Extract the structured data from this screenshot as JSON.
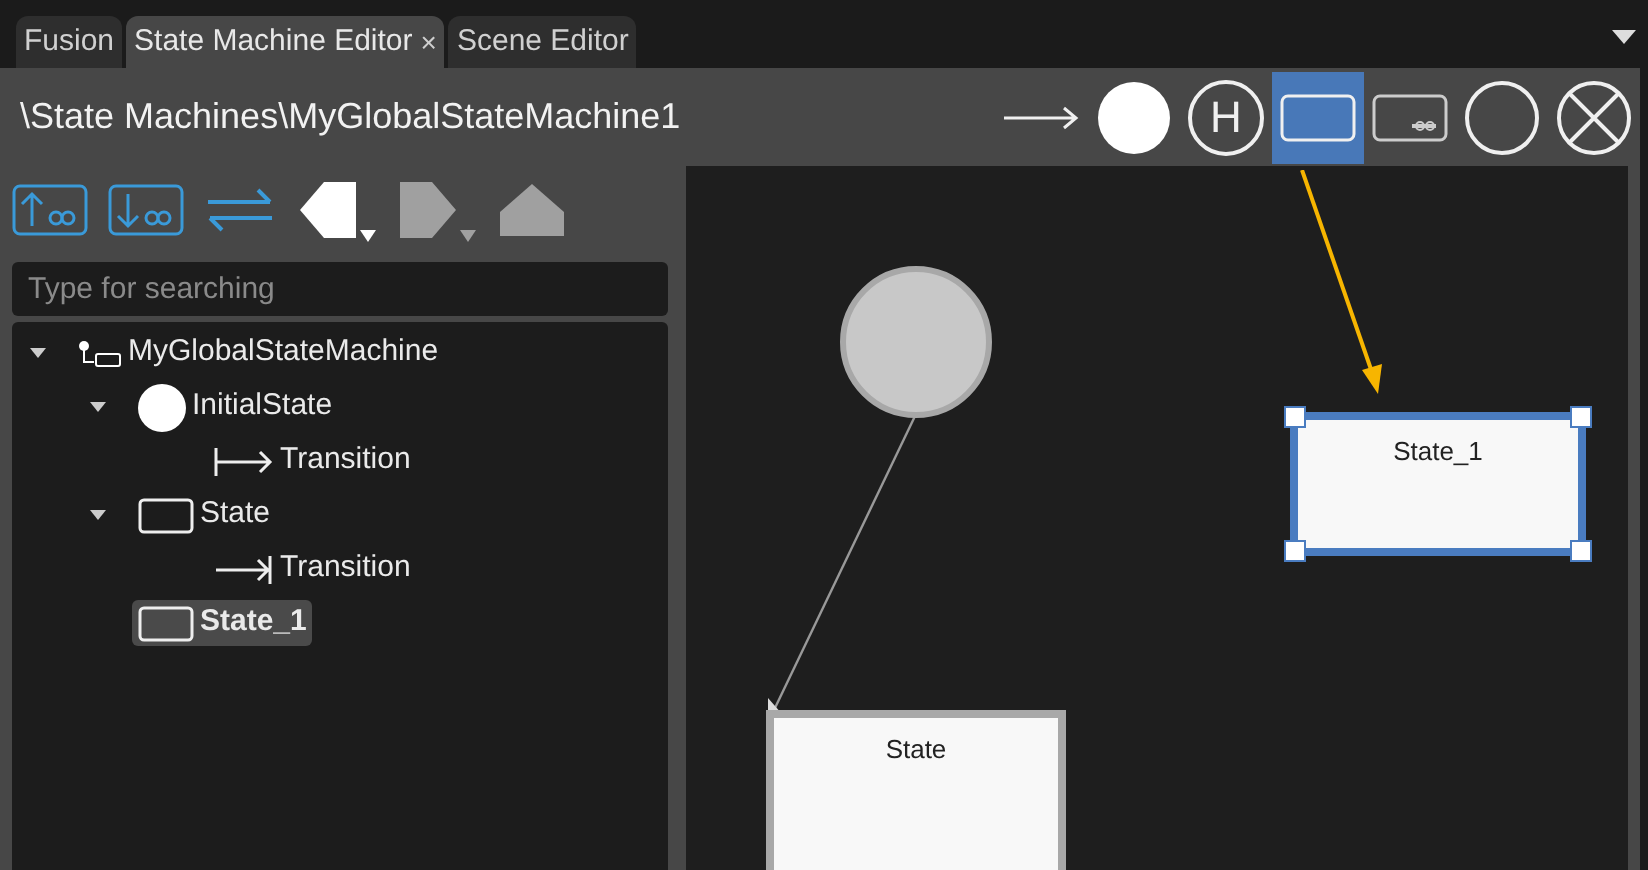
{
  "tabs": [
    {
      "label": "Fusion",
      "selected": false
    },
    {
      "label": "State Machine Editor",
      "selected": true,
      "close": "×"
    },
    {
      "label": "Scene Editor",
      "selected": false
    }
  ],
  "path": "\\State Machines\\MyGlobalStateMachine1",
  "tools": [
    {
      "kind": "transition",
      "selected": false
    },
    {
      "kind": "initial",
      "selected": false
    },
    {
      "kind": "history",
      "selected": false,
      "glyph": "H"
    },
    {
      "kind": "state",
      "selected": true
    },
    {
      "kind": "submachine",
      "selected": false
    },
    {
      "kind": "final",
      "selected": false
    },
    {
      "kind": "terminate",
      "selected": false
    }
  ],
  "left_toolbar": [
    {
      "kind": "move-up",
      "disabled": false
    },
    {
      "kind": "move-down",
      "disabled": false
    },
    {
      "kind": "swap",
      "disabled": false
    },
    {
      "kind": "back",
      "disabled": false,
      "dropdown": true
    },
    {
      "kind": "forward",
      "disabled": true,
      "dropdown": true
    },
    {
      "kind": "up",
      "disabled": true
    }
  ],
  "search": {
    "placeholder": "Type for searching"
  },
  "tree": [
    {
      "label": "MyGlobalStateMachine",
      "kind": "machine",
      "expanded": true,
      "selected": false,
      "children": [
        {
          "label": "InitialState",
          "kind": "initial",
          "expanded": true,
          "selected": false,
          "children": [
            {
              "label": "Transition",
              "kind": "transition-out",
              "selected": false
            }
          ]
        },
        {
          "label": "State",
          "kind": "state",
          "expanded": true,
          "selected": false,
          "children": [
            {
              "label": "Transition",
              "kind": "transition-in",
              "selected": false
            }
          ]
        },
        {
          "label": "State_1",
          "kind": "state",
          "selected": true
        }
      ]
    }
  ],
  "canvas": {
    "nodes": [
      {
        "kind": "initial",
        "selected": false
      },
      {
        "kind": "state",
        "label": "State_1",
        "selected": true
      },
      {
        "kind": "state",
        "label": "State",
        "selected": false
      }
    ]
  }
}
